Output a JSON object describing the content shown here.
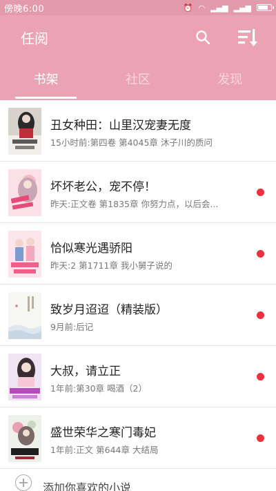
{
  "status_bar": {
    "time": "傍晚6:00"
  },
  "header": {
    "title": "任阅",
    "tabs": [
      "书架",
      "社区",
      "发现"
    ],
    "active_tab": 0
  },
  "books": [
    {
      "title": "丑女种田：山里汉宠妻无度",
      "info": "15小时前:第四卷 第4045章 沐子川的质问",
      "unread": false,
      "cover": "dark"
    },
    {
      "title": "坏坏老公，宠不停！",
      "info": "昨天:正文卷 第1835章 你努力点，以后会...",
      "unread": true,
      "cover": "pink"
    },
    {
      "title": "恰似寒光遇骄阳",
      "info": "昨天:2 第1711章 我小舅子说的",
      "unread": true,
      "cover": "rose"
    },
    {
      "title": "致岁月迢迢（精装版）",
      "info": "9月前:后记",
      "unread": true,
      "cover": "light"
    },
    {
      "title": "大叔，请立正",
      "info": "1年前:第30章 喝酒（2）",
      "unread": true,
      "cover": "purple"
    },
    {
      "title": "盛世荣华之寒门毒妃",
      "info": "1年前:正文 第644章 大结局",
      "unread": true,
      "cover": "ink"
    }
  ],
  "add_row": {
    "label": "添加你喜欢的小说"
  },
  "colors": {
    "header_bg": "#eba3b4",
    "status_bg": "#e39aab",
    "unread_dot": "#e8323c"
  }
}
